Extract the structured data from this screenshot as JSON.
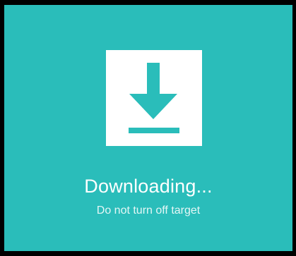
{
  "status": {
    "title": "Downloading...",
    "subtitle": "Do not turn off target"
  },
  "icon": {
    "name": "download-icon"
  },
  "colors": {
    "background": "#2ABDBA",
    "icon_box": "#FFFFFF",
    "text": "#FFFFFF",
    "frame": "#000000"
  }
}
